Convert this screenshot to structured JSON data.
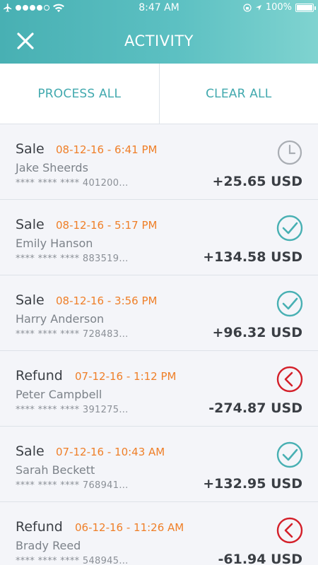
{
  "status_bar": {
    "time": "8:47 AM",
    "battery": "100%"
  },
  "header": {
    "title": "ACTIVITY",
    "close_icon": "close-icon"
  },
  "actions": {
    "process_all": "PROCESS ALL",
    "clear_all": "CLEAR ALL"
  },
  "transactions": [
    {
      "type": "Sale",
      "date": "08-12-16 - 6:41 PM",
      "name": "Jake Sheerds",
      "card": "**** **** **** 401200...",
      "amount": "+25.65 USD",
      "status": "pending",
      "status_icon": "clock-icon"
    },
    {
      "type": "Sale",
      "date": "08-12-16 - 5:17 PM",
      "name": "Emily Hanson",
      "card": "**** **** **** 883519...",
      "amount": "+134.58 USD",
      "status": "completed",
      "status_icon": "check-circle-icon"
    },
    {
      "type": "Sale",
      "date": "08-12-16 - 3:56 PM",
      "name": "Harry Anderson",
      "card": "**** **** **** 728483...",
      "amount": "+96.32 USD",
      "status": "completed",
      "status_icon": "check-circle-icon"
    },
    {
      "type": "Refund",
      "date": "07-12-16 - 1:12 PM",
      "name": "Peter Campbell",
      "card": "**** **** **** 391275...",
      "amount": "-274.87 USD",
      "status": "refund",
      "status_icon": "back-arrow-circle-icon"
    },
    {
      "type": "Sale",
      "date": "07-12-16 - 10:43 AM",
      "name": "Sarah Beckett",
      "card": "**** **** **** 768941...",
      "amount": "+132.95 USD",
      "status": "completed",
      "status_icon": "check-circle-icon"
    },
    {
      "type": "Refund",
      "date": "06-12-16 - 11:26 AM",
      "name": "Brady Reed",
      "card": "**** **** **** 548945...",
      "amount": "-61.94 USD",
      "status": "refund",
      "status_icon": "back-arrow-circle-icon"
    }
  ],
  "colors": {
    "accent": "#48b0b3",
    "date": "#ef7f28",
    "refund": "#d4202a",
    "pending": "#a9adb3"
  }
}
